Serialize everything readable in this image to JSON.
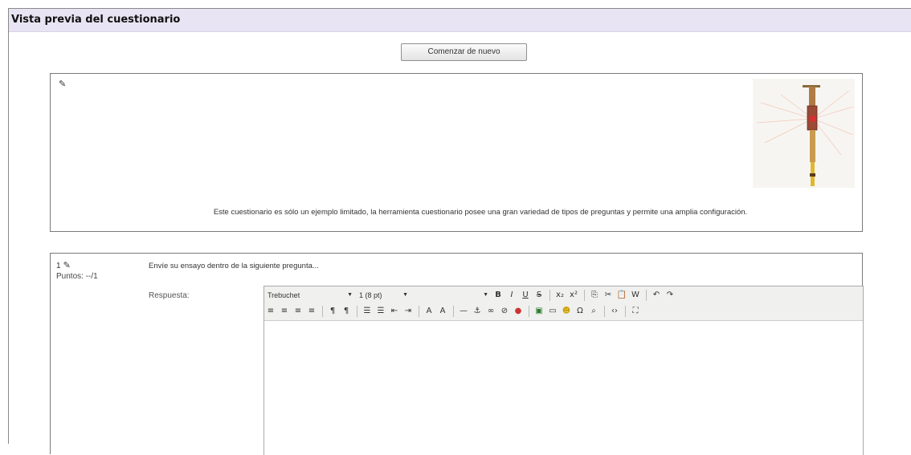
{
  "header": {
    "title": "Vista previa del cuestionario"
  },
  "restart_button": {
    "label": "Comenzar de nuevo"
  },
  "intro": {
    "edit_icon": "edit-icon",
    "text": "Este cuestionario es sólo un ejemplo limitado, la herramienta cuestionario posee una gran variedad de tipos de preguntas y permite una amplia configuración."
  },
  "question": {
    "number": "1",
    "points": "Puntos: --/1",
    "text": "Envíe su ensayo dentro de la siguiente pregunta...",
    "answer_label": "Respuesta:"
  },
  "editor": {
    "font_family": "Trebuchet",
    "font_size": "1 (8 pt)",
    "format": ""
  },
  "colors": {
    "header_bg": "#e9e4f3",
    "border": "#7a7a7a"
  }
}
